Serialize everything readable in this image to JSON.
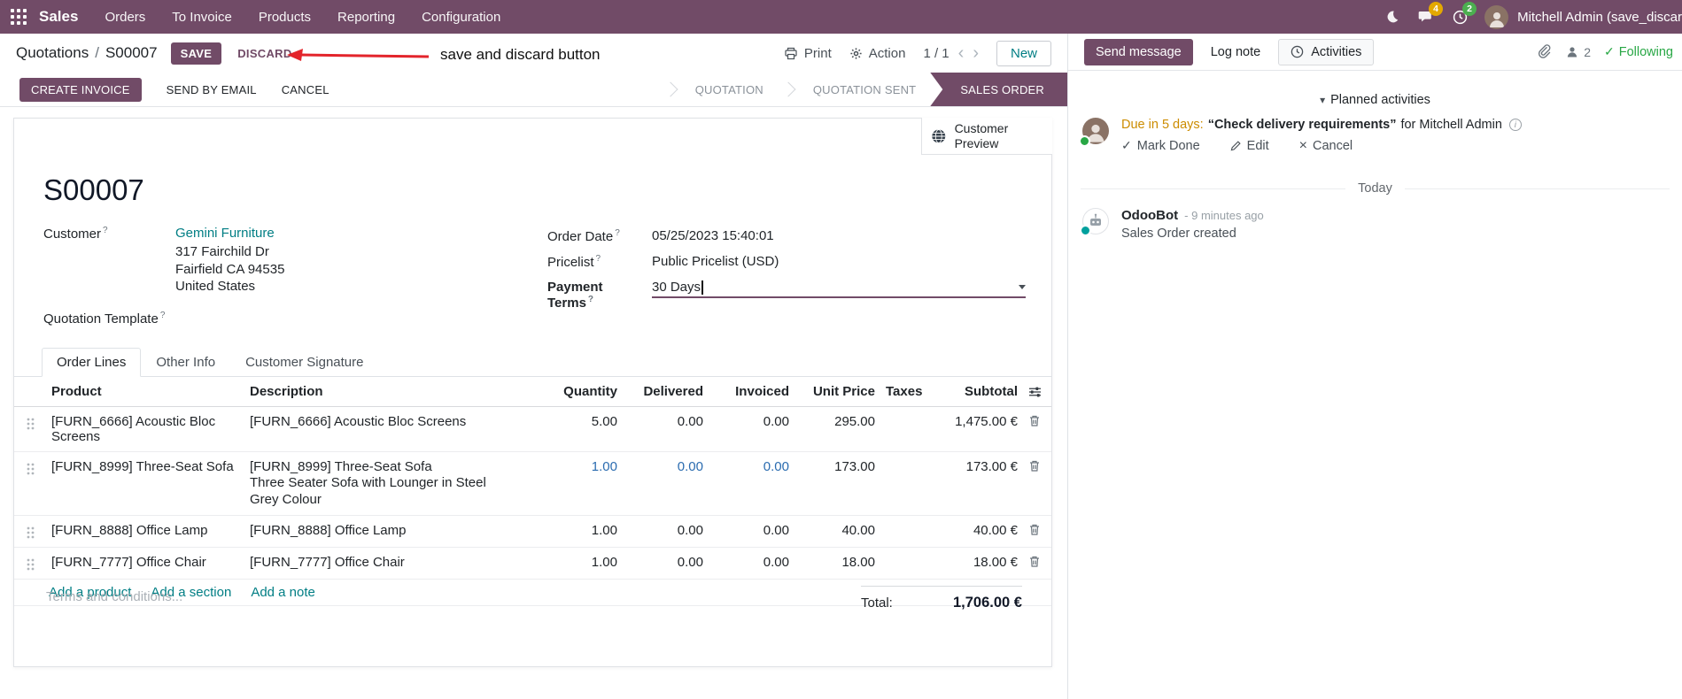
{
  "colors": {
    "brand_purple": "#714B67",
    "link_teal": "#017E84",
    "highlight_blue": "#2B6CB0",
    "due_warning_orange": "#CC8C00",
    "annotation_red": "#E3242B",
    "success_green": "#28A745"
  },
  "icons": {
    "caret_down": "▾",
    "chevron_left": "‹",
    "chevron_right": "›",
    "check": "✓",
    "close": "×",
    "question": "?",
    "info": "i"
  },
  "topbar": {
    "app_name": "Sales",
    "menus": [
      "Orders",
      "To Invoice",
      "Products",
      "Reporting",
      "Configuration"
    ],
    "message_badge": "4",
    "activity_badge": "2",
    "user_name": "Mitchell Admin (save_discar"
  },
  "control_panel": {
    "breadcrumb_parent": "Quotations",
    "breadcrumb_separator": "/",
    "breadcrumb_current": "S00007",
    "save": "SAVE",
    "discard": "DISCARD",
    "print": "Print",
    "action": "Action",
    "pager": "1 / 1",
    "new": "New"
  },
  "annotation": {
    "text": "save and discard button"
  },
  "statusbar": {
    "create_invoice": "CREATE INVOICE",
    "send_by_email": "SEND BY EMAIL",
    "cancel": "CANCEL",
    "stages": [
      {
        "label": "QUOTATION"
      },
      {
        "label": "QUOTATION SENT"
      },
      {
        "label": "SALES ORDER"
      }
    ]
  },
  "sheet": {
    "customer_preview": "Customer Preview",
    "title": "S00007",
    "customer": {
      "label": "Customer",
      "name": "Gemini Furniture",
      "address": [
        "317 Fairchild Dr",
        "Fairfield CA 94535",
        "United States"
      ]
    },
    "quotation_template_label": "Quotation Template",
    "order_date": {
      "label": "Order Date",
      "value": "05/25/2023 15:40:01"
    },
    "pricelist": {
      "label": "Pricelist",
      "value": "Public Pricelist (USD)"
    },
    "payment_terms": {
      "label": "Payment Terms",
      "value": "30 Days"
    },
    "tabs": [
      "Order Lines",
      "Other Info",
      "Customer Signature"
    ],
    "table": {
      "headers": {
        "product": "Product",
        "description": "Description",
        "quantity": "Quantity",
        "delivered": "Delivered",
        "invoiced": "Invoiced",
        "unit_price": "Unit Price",
        "taxes": "Taxes",
        "subtotal": "Subtotal"
      },
      "rows": [
        {
          "product": "[FURN_6666] Acoustic Bloc Screens",
          "description": "[FURN_6666] Acoustic Bloc Screens",
          "description2": "",
          "quantity": "5.00",
          "delivered": "0.00",
          "invoiced": "0.00",
          "unit_price": "295.00",
          "taxes": "",
          "subtotal": "1,475.00 €"
        },
        {
          "product": "[FURN_8999] Three-Seat Sofa",
          "description": "[FURN_8999] Three-Seat Sofa",
          "description2": "Three Seater Sofa with Lounger in Steel Grey Colour",
          "quantity": "1.00",
          "delivered": "0.00",
          "invoiced": "0.00",
          "unit_price": "173.00",
          "taxes": "",
          "subtotal": "173.00 €"
        },
        {
          "product": "[FURN_8888] Office Lamp",
          "description": "[FURN_8888] Office Lamp",
          "description2": "",
          "quantity": "1.00",
          "delivered": "0.00",
          "invoiced": "0.00",
          "unit_price": "40.00",
          "taxes": "",
          "subtotal": "40.00 €"
        },
        {
          "product": "[FURN_7777] Office Chair",
          "description": "[FURN_7777] Office Chair",
          "description2": "",
          "quantity": "1.00",
          "delivered": "0.00",
          "invoiced": "0.00",
          "unit_price": "18.00",
          "taxes": "",
          "subtotal": "18.00 €"
        }
      ],
      "add_links": [
        "Add a product",
        "Add a section",
        "Add a note"
      ]
    },
    "terms_placeholder": "Terms and conditions...",
    "total": {
      "label": "Total:",
      "value": "1,706.00 €"
    }
  },
  "chatter": {
    "send_message": "Send message",
    "log_note": "Log note",
    "activities": "Activities",
    "follower_count": "2",
    "following": "Following",
    "planned_activities": "Planned activities",
    "activity": {
      "due": "Due in 5 days:",
      "summary": "“Check delivery requirements”",
      "assignee": "for Mitchell Admin",
      "mark_done": "Mark Done",
      "edit": "Edit",
      "cancel": "Cancel"
    },
    "today": "Today",
    "message": {
      "author": "OdooBot",
      "time": "- 9 minutes ago",
      "body": "Sales Order created"
    }
  }
}
